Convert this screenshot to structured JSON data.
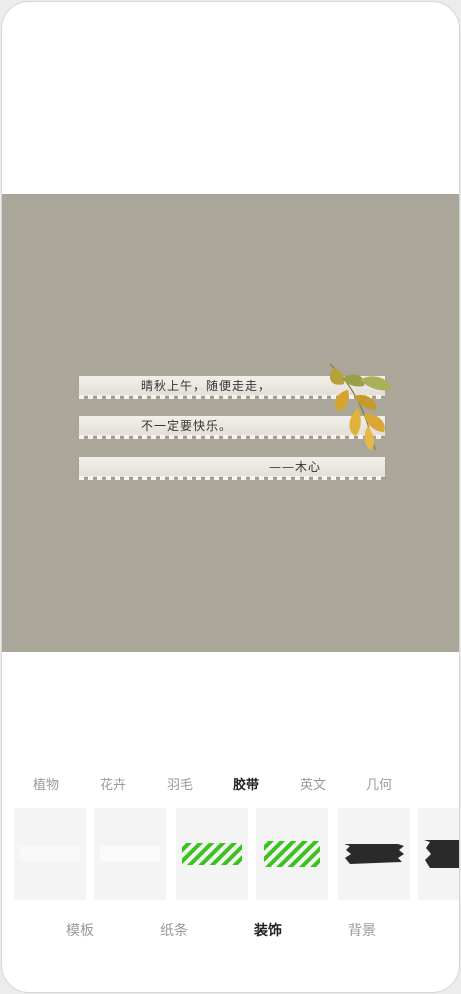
{
  "poem": {
    "line1": "晴秋上午，随便走走，",
    "line2": "不一定要快乐。",
    "author": "——木心"
  },
  "category_tabs": [
    {
      "label": "植物",
      "active": false
    },
    {
      "label": "花卉",
      "active": false
    },
    {
      "label": "羽毛",
      "active": false
    },
    {
      "label": "胶带",
      "active": true
    },
    {
      "label": "英文",
      "active": false
    },
    {
      "label": "几何",
      "active": false
    }
  ],
  "tape_tiles": [
    {
      "style": "plain-white"
    },
    {
      "style": "plain-white"
    },
    {
      "style": "green-stripes"
    },
    {
      "style": "green-stripes"
    },
    {
      "style": "black-torn"
    },
    {
      "style": "black-torn"
    }
  ],
  "bottom_nav": [
    {
      "label": "模板",
      "active": false
    },
    {
      "label": "纸条",
      "active": false
    },
    {
      "label": "装饰",
      "active": true
    },
    {
      "label": "背景",
      "active": false
    }
  ],
  "colors": {
    "canvas_background": "#aaa69a",
    "paper_strip": "#ebe7e0",
    "stripe_green": "#3cc21e",
    "tape_black": "#2a2a2a",
    "active_text": "#222222",
    "inactive_text": "#9a9a9a"
  }
}
